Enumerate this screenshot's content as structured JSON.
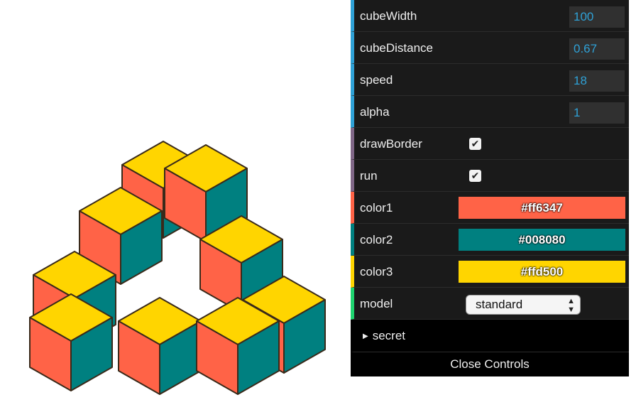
{
  "colors": {
    "color1": "#ff6347",
    "color2": "#008080",
    "color3": "#ffd500"
  },
  "controls": {
    "cubeWidth": {
      "label": "cubeWidth",
      "value": "100"
    },
    "cubeDistance": {
      "label": "cubeDistance",
      "value": "0.67"
    },
    "speed": {
      "label": "speed",
      "value": "18"
    },
    "alpha": {
      "label": "alpha",
      "value": "1"
    },
    "drawBorder": {
      "label": "drawBorder",
      "checked": true,
      "mark": "✔"
    },
    "run": {
      "label": "run",
      "checked": true,
      "mark": "✔"
    },
    "color1": {
      "label": "color1",
      "value": "#ff6347"
    },
    "color2": {
      "label": "color2",
      "value": "#008080"
    },
    "color3": {
      "label": "color3",
      "value": "#ffd500"
    },
    "model": {
      "label": "model",
      "selected": "standard",
      "arrows": "▲▼"
    },
    "secret": {
      "label": "secret",
      "icon": "triangle-right-icon"
    },
    "close_label": "Close Controls"
  }
}
